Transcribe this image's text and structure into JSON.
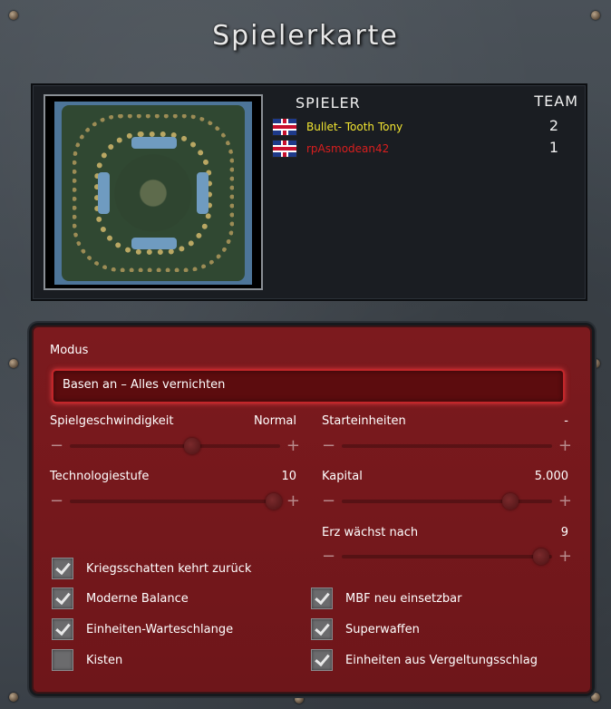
{
  "title": "Spielerkarte",
  "players": {
    "header_player": "SPIELER",
    "header_team": "TEAM",
    "list": [
      {
        "name": "Bullet- Tooth Tony",
        "team": "2",
        "color": "#f2e531"
      },
      {
        "name": "rpAsmodean42",
        "team": "1",
        "color": "#d81e1e"
      }
    ]
  },
  "settings": {
    "mode_label": "Modus",
    "mode_value": "Basen an – Alles vernichten",
    "game_speed_label": "Spielgeschwindigkeit",
    "game_speed_value": "Normal",
    "game_speed_level": 0.58,
    "start_units_label": "Starteinheiten",
    "start_units_value": "-",
    "start_units_level": 0.0,
    "tech_level_label": "Technologiestufe",
    "tech_level_value": "10",
    "tech_level_level": 0.97,
    "capital_label": "Kapital",
    "capital_value": "5.000",
    "capital_level": 0.8,
    "ore_regrowth_label": "Erz wächst nach",
    "ore_regrowth_value": "9",
    "ore_regrowth_level": 0.95,
    "minus": "−",
    "plus": "+"
  },
  "checkboxes": {
    "shroud": {
      "label": "Kriegsschatten kehrt zurück",
      "checked": true
    },
    "modern_balance": {
      "label": "Moderne Balance",
      "checked": true
    },
    "mcv_repacks": {
      "label": "MBF neu einsetzbar",
      "checked": true
    },
    "unit_queue": {
      "label": "Einheiten-Warteschlange",
      "checked": true
    },
    "superweapons": {
      "label": "Superwaffen",
      "checked": true
    },
    "crates": {
      "label": "Kisten",
      "checked": false
    },
    "retaliation_units": {
      "label": "Einheiten aus Vergeltungsschlag",
      "checked": true
    }
  }
}
